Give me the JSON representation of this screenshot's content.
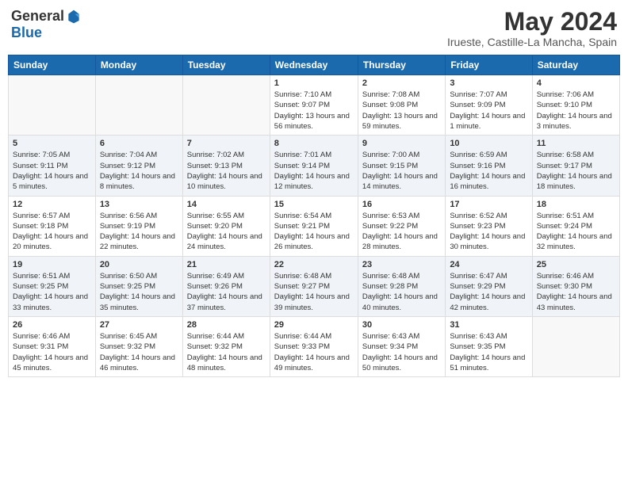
{
  "logo": {
    "general": "General",
    "blue": "Blue"
  },
  "title": {
    "month_year": "May 2024",
    "location": "Irueste, Castille-La Mancha, Spain"
  },
  "weekdays": [
    "Sunday",
    "Monday",
    "Tuesday",
    "Wednesday",
    "Thursday",
    "Friday",
    "Saturday"
  ],
  "weeks": [
    [
      {
        "day": "",
        "info": ""
      },
      {
        "day": "",
        "info": ""
      },
      {
        "day": "",
        "info": ""
      },
      {
        "day": "1",
        "info": "Sunrise: 7:10 AM\nSunset: 9:07 PM\nDaylight: 13 hours\nand 56 minutes."
      },
      {
        "day": "2",
        "info": "Sunrise: 7:08 AM\nSunset: 9:08 PM\nDaylight: 13 hours\nand 59 minutes."
      },
      {
        "day": "3",
        "info": "Sunrise: 7:07 AM\nSunset: 9:09 PM\nDaylight: 14 hours\nand 1 minute."
      },
      {
        "day": "4",
        "info": "Sunrise: 7:06 AM\nSunset: 9:10 PM\nDaylight: 14 hours\nand 3 minutes."
      }
    ],
    [
      {
        "day": "5",
        "info": "Sunrise: 7:05 AM\nSunset: 9:11 PM\nDaylight: 14 hours\nand 5 minutes."
      },
      {
        "day": "6",
        "info": "Sunrise: 7:04 AM\nSunset: 9:12 PM\nDaylight: 14 hours\nand 8 minutes."
      },
      {
        "day": "7",
        "info": "Sunrise: 7:02 AM\nSunset: 9:13 PM\nDaylight: 14 hours\nand 10 minutes."
      },
      {
        "day": "8",
        "info": "Sunrise: 7:01 AM\nSunset: 9:14 PM\nDaylight: 14 hours\nand 12 minutes."
      },
      {
        "day": "9",
        "info": "Sunrise: 7:00 AM\nSunset: 9:15 PM\nDaylight: 14 hours\nand 14 minutes."
      },
      {
        "day": "10",
        "info": "Sunrise: 6:59 AM\nSunset: 9:16 PM\nDaylight: 14 hours\nand 16 minutes."
      },
      {
        "day": "11",
        "info": "Sunrise: 6:58 AM\nSunset: 9:17 PM\nDaylight: 14 hours\nand 18 minutes."
      }
    ],
    [
      {
        "day": "12",
        "info": "Sunrise: 6:57 AM\nSunset: 9:18 PM\nDaylight: 14 hours\nand 20 minutes."
      },
      {
        "day": "13",
        "info": "Sunrise: 6:56 AM\nSunset: 9:19 PM\nDaylight: 14 hours\nand 22 minutes."
      },
      {
        "day": "14",
        "info": "Sunrise: 6:55 AM\nSunset: 9:20 PM\nDaylight: 14 hours\nand 24 minutes."
      },
      {
        "day": "15",
        "info": "Sunrise: 6:54 AM\nSunset: 9:21 PM\nDaylight: 14 hours\nand 26 minutes."
      },
      {
        "day": "16",
        "info": "Sunrise: 6:53 AM\nSunset: 9:22 PM\nDaylight: 14 hours\nand 28 minutes."
      },
      {
        "day": "17",
        "info": "Sunrise: 6:52 AM\nSunset: 9:23 PM\nDaylight: 14 hours\nand 30 minutes."
      },
      {
        "day": "18",
        "info": "Sunrise: 6:51 AM\nSunset: 9:24 PM\nDaylight: 14 hours\nand 32 minutes."
      }
    ],
    [
      {
        "day": "19",
        "info": "Sunrise: 6:51 AM\nSunset: 9:25 PM\nDaylight: 14 hours\nand 33 minutes."
      },
      {
        "day": "20",
        "info": "Sunrise: 6:50 AM\nSunset: 9:25 PM\nDaylight: 14 hours\nand 35 minutes."
      },
      {
        "day": "21",
        "info": "Sunrise: 6:49 AM\nSunset: 9:26 PM\nDaylight: 14 hours\nand 37 minutes."
      },
      {
        "day": "22",
        "info": "Sunrise: 6:48 AM\nSunset: 9:27 PM\nDaylight: 14 hours\nand 39 minutes."
      },
      {
        "day": "23",
        "info": "Sunrise: 6:48 AM\nSunset: 9:28 PM\nDaylight: 14 hours\nand 40 minutes."
      },
      {
        "day": "24",
        "info": "Sunrise: 6:47 AM\nSunset: 9:29 PM\nDaylight: 14 hours\nand 42 minutes."
      },
      {
        "day": "25",
        "info": "Sunrise: 6:46 AM\nSunset: 9:30 PM\nDaylight: 14 hours\nand 43 minutes."
      }
    ],
    [
      {
        "day": "26",
        "info": "Sunrise: 6:46 AM\nSunset: 9:31 PM\nDaylight: 14 hours\nand 45 minutes."
      },
      {
        "day": "27",
        "info": "Sunrise: 6:45 AM\nSunset: 9:32 PM\nDaylight: 14 hours\nand 46 minutes."
      },
      {
        "day": "28",
        "info": "Sunrise: 6:44 AM\nSunset: 9:32 PM\nDaylight: 14 hours\nand 48 minutes."
      },
      {
        "day": "29",
        "info": "Sunrise: 6:44 AM\nSunset: 9:33 PM\nDaylight: 14 hours\nand 49 minutes."
      },
      {
        "day": "30",
        "info": "Sunrise: 6:43 AM\nSunset: 9:34 PM\nDaylight: 14 hours\nand 50 minutes."
      },
      {
        "day": "31",
        "info": "Sunrise: 6:43 AM\nSunset: 9:35 PM\nDaylight: 14 hours\nand 51 minutes."
      },
      {
        "day": "",
        "info": ""
      }
    ]
  ]
}
